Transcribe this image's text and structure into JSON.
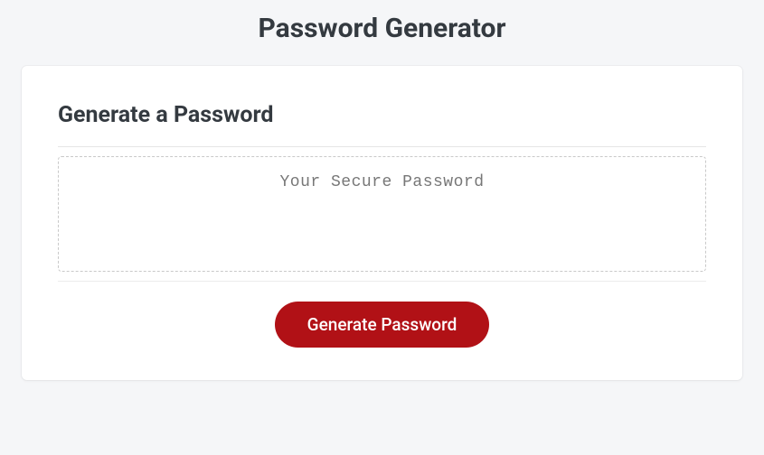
{
  "header": {
    "title": "Password Generator"
  },
  "card": {
    "heading": "Generate a Password",
    "output_placeholder": "Your Secure Password",
    "generate_button_label": "Generate Password"
  }
}
